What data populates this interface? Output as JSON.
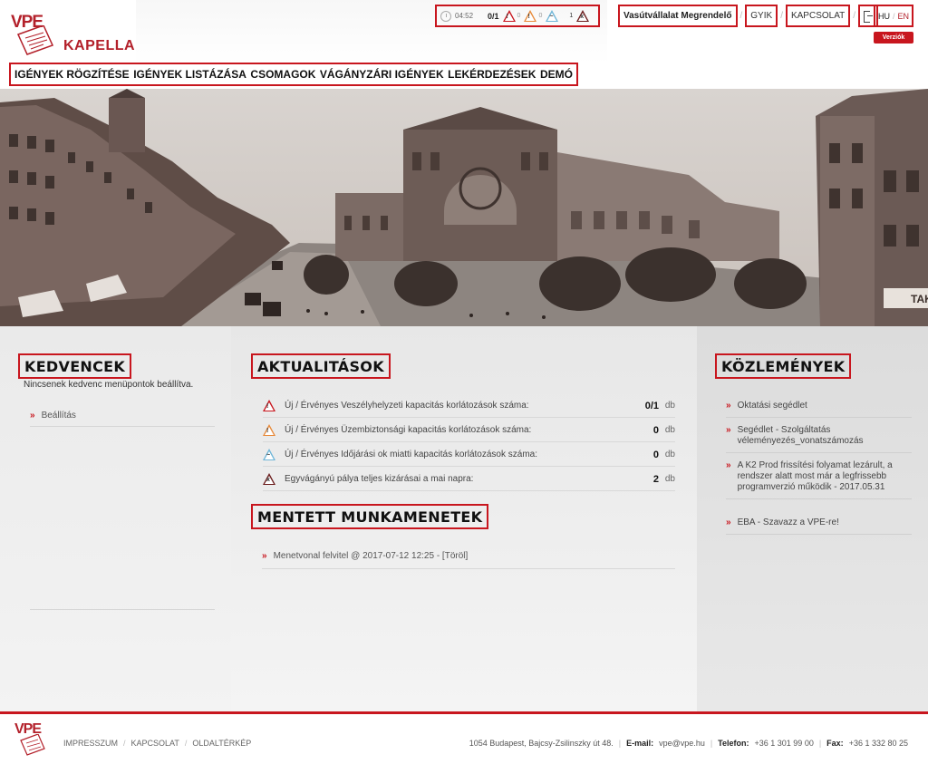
{
  "header": {
    "logo_vpe": "VPE",
    "logo_name": "KAPELLA",
    "status": {
      "time": "04:52",
      "fraction": "0/1",
      "orange_count": "0",
      "blue_count": "0",
      "dark_count": "1"
    },
    "topnav": {
      "user": "Vasútvállalat Megrendelő",
      "faq": "GYIK",
      "contact": "KAPCSOLAT"
    },
    "lang": {
      "hu": "HU",
      "en": "EN"
    },
    "versions_button": "Verziók"
  },
  "mainnav": [
    "IGÉNYEK RÖGZÍTÉSE",
    "IGÉNYEK LISTÁZÁSA",
    "CSOMAGOK",
    "VÁGÁNYZÁRI IGÉNYEK",
    "LEKÉRDEZÉSEK",
    "DEMÓ"
  ],
  "favorites": {
    "title": "KEDVENCEK",
    "empty_text": "Nincsenek kedvenc menüpontok beállítva.",
    "settings_link": "Beállítás"
  },
  "actualities": {
    "title": "AKTUALITÁSOK",
    "rows": [
      {
        "text": "Új / Érvényes Veszélyhelyzeti kapacitás korlátozások száma:",
        "value": "0/1",
        "unit": "db"
      },
      {
        "text": "Új / Érvényes Üzembiztonsági kapacitás korlátozások száma:",
        "value": "0",
        "unit": "db"
      },
      {
        "text": "Új / Érvényes Időjárási ok miatti kapacitás korlátozások száma:",
        "value": "0",
        "unit": "db"
      },
      {
        "text": "Egyvágányú pálya teljes kizárásai a mai napra:",
        "value": "2",
        "unit": "db"
      }
    ]
  },
  "sessions": {
    "title": "MENTETT MUNKAMENETEK",
    "item": "Menetvonal felvitel @ 2017-07-12 12:25 - [Töröl]"
  },
  "announcements": {
    "title": "KÖZLEMÉNYEK",
    "items": [
      "Oktatási segédlet",
      "Segédlet - Szolgáltatás véleményezés_vonatszámozás",
      "A K2 Prod frissítési folyamat lezárult, a rendszer alatt most már a legfrissebb programverzió működik - 2017.05.31",
      "EBA - Szavazz a VPE-re!"
    ]
  },
  "footer": {
    "logo": "VPE",
    "links": [
      "IMPRESSZUM",
      "KAPCSOLAT",
      "OLDALTÉRKÉP"
    ],
    "address": "1054 Budapest, Bajcsy-Zsilinszky út 48.",
    "email_label": "E-mail:",
    "email": "vpe@vpe.hu",
    "phone_label": "Telefon:",
    "phone": "+36 1 301 99 00",
    "fax_label": "Fax:",
    "fax": "+36 1 332 80 25"
  },
  "colors": {
    "accent": "#c8161e",
    "brand": "#b3202a"
  }
}
